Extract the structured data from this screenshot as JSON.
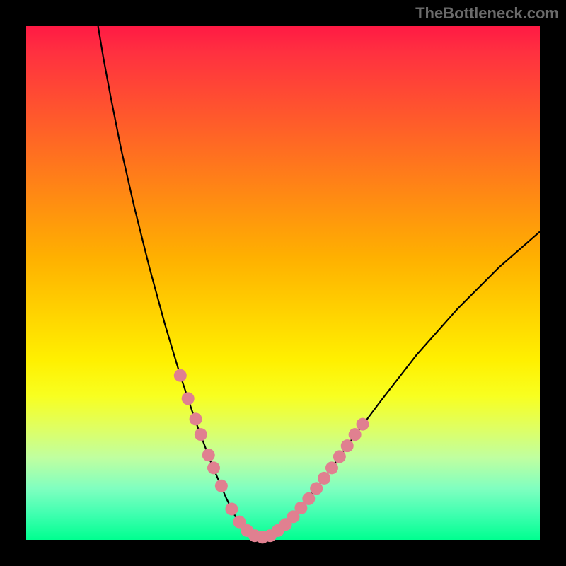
{
  "watermark": "TheBottleneck.com",
  "chart_data": {
    "type": "line",
    "title": "",
    "xlabel": "",
    "ylabel": "",
    "xlim": [
      0,
      100
    ],
    "ylim": [
      0,
      100
    ],
    "curve": {
      "description": "V-shaped bottleneck curve",
      "points": [
        {
          "x": 14.0,
          "y": 100.0
        },
        {
          "x": 15.0,
          "y": 94.0
        },
        {
          "x": 16.5,
          "y": 86.0
        },
        {
          "x": 18.5,
          "y": 76.0
        },
        {
          "x": 21.0,
          "y": 65.0
        },
        {
          "x": 24.0,
          "y": 53.0
        },
        {
          "x": 27.0,
          "y": 42.0
        },
        {
          "x": 30.0,
          "y": 32.0
        },
        {
          "x": 33.0,
          "y": 23.0
        },
        {
          "x": 36.0,
          "y": 15.0
        },
        {
          "x": 39.0,
          "y": 8.0
        },
        {
          "x": 41.0,
          "y": 4.0
        },
        {
          "x": 43.0,
          "y": 1.5
        },
        {
          "x": 45.0,
          "y": 0.5
        },
        {
          "x": 47.0,
          "y": 0.5
        },
        {
          "x": 49.0,
          "y": 1.5
        },
        {
          "x": 51.0,
          "y": 3.5
        },
        {
          "x": 54.0,
          "y": 7.0
        },
        {
          "x": 58.0,
          "y": 12.0
        },
        {
          "x": 63.0,
          "y": 19.0
        },
        {
          "x": 69.0,
          "y": 27.0
        },
        {
          "x": 76.0,
          "y": 36.0
        },
        {
          "x": 84.0,
          "y": 45.0
        },
        {
          "x": 92.0,
          "y": 53.0
        },
        {
          "x": 100.0,
          "y": 60.0
        }
      ]
    },
    "highlighted_points": {
      "description": "Pink/salmon data point markers on lower V section",
      "color": "#e08090",
      "points": [
        {
          "x": 30.0,
          "y": 32.0
        },
        {
          "x": 31.5,
          "y": 27.5
        },
        {
          "x": 33.0,
          "y": 23.5
        },
        {
          "x": 34.0,
          "y": 20.5
        },
        {
          "x": 35.5,
          "y": 16.5
        },
        {
          "x": 36.5,
          "y": 14.0
        },
        {
          "x": 38.0,
          "y": 10.5
        },
        {
          "x": 40.0,
          "y": 6.0
        },
        {
          "x": 41.5,
          "y": 3.5
        },
        {
          "x": 43.0,
          "y": 1.8
        },
        {
          "x": 44.5,
          "y": 0.8
        },
        {
          "x": 46.0,
          "y": 0.5
        },
        {
          "x": 47.5,
          "y": 0.8
        },
        {
          "x": 49.0,
          "y": 1.8
        },
        {
          "x": 50.5,
          "y": 3.0
        },
        {
          "x": 52.0,
          "y": 4.5
        },
        {
          "x": 53.5,
          "y": 6.2
        },
        {
          "x": 55.0,
          "y": 8.0
        },
        {
          "x": 56.5,
          "y": 10.0
        },
        {
          "x": 58.0,
          "y": 12.0
        },
        {
          "x": 59.5,
          "y": 14.0
        },
        {
          "x": 61.0,
          "y": 16.2
        },
        {
          "x": 62.5,
          "y": 18.3
        },
        {
          "x": 64.0,
          "y": 20.5
        },
        {
          "x": 65.5,
          "y": 22.5
        }
      ]
    }
  },
  "colors": {
    "background_frame": "#000000",
    "curve": "#000000",
    "markers": "#e08090",
    "watermark": "#6a6a6a"
  }
}
